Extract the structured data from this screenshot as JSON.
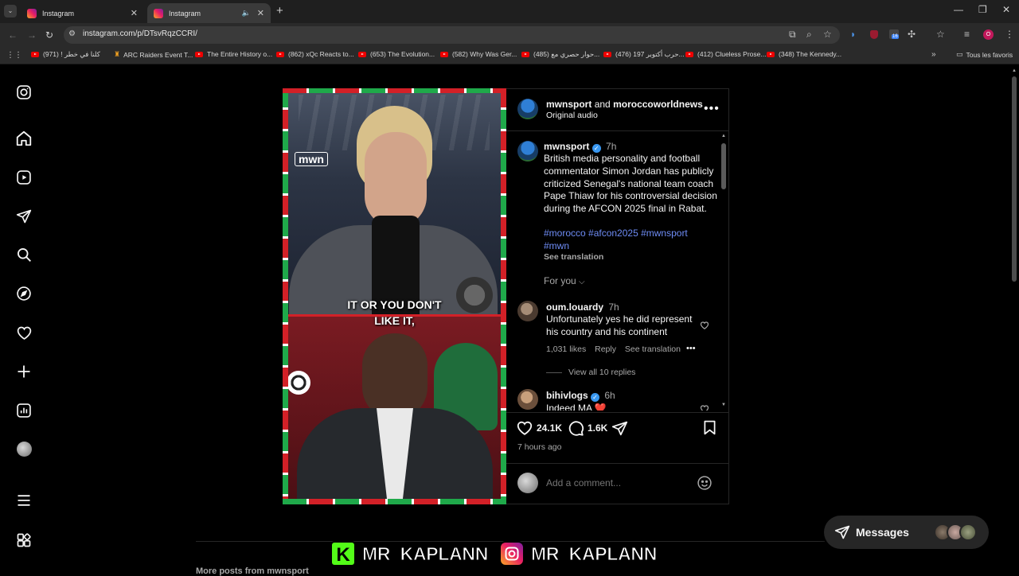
{
  "browser": {
    "tabs": [
      {
        "title": "Instagram",
        "active": false
      },
      {
        "title": "Instagram",
        "active": true
      }
    ],
    "url": "instagram.com/p/DTsvRqzCCRI/",
    "profile_initial": "O",
    "extension_badge": "16",
    "bookmarks": [
      "كلنا في خطر ! (971)",
      "ARC Raiders Event T...",
      "The Entire History o...",
      "(862) xQc Reacts to...",
      "(653) The Evolution...",
      "(582) Why Was Ger...",
      "(485) حوار حصري مع...",
      "(476) حرب أكتوبر 197...",
      "(412) Clueless Prose...",
      "(348) The Kennedy..."
    ],
    "all_bookmarks_label": "Tous les favoris"
  },
  "post": {
    "header": {
      "author1": "mwnsport",
      "joiner": "and",
      "author2": "moroccoworldnews",
      "audio": "Original audio",
      "more_icon": "more-horizontal-icon"
    },
    "video": {
      "caption_line1": "IT OR YOU DON'T",
      "caption_line2": "LIKE IT,",
      "logo_text": "mwn",
      "frame_colors": [
        "#d32027",
        "#1fa94a",
        "#ffffff"
      ]
    },
    "caption": {
      "username": "mwnsport",
      "verified": true,
      "time": "7h",
      "text": "British media personality and football commentator Simon Jordan has publicly criticized Senegal's national team coach Pape Thiaw for his controversial decision during the AFCON 2025 final in Rabat.",
      "hashtags": "#morocco #afcon2025 #mwnsport #mwn",
      "see_translation": "See translation"
    },
    "sort_label": "For you",
    "comments": [
      {
        "username": "oum.louardy",
        "time": "7h",
        "text": "Unfortunately yes he did represent his country and his continent",
        "likes": "1,031 likes",
        "reply": "Reply",
        "see_translation": "See translation",
        "view_replies": "View all 10 replies"
      },
      {
        "username": "bihivlogs",
        "verified": true,
        "time": "6h",
        "text": "Indeed MA ❤️"
      }
    ],
    "actions": {
      "likes": "24.1K",
      "comments": "1.6K"
    },
    "posted_ago": "7 hours ago",
    "comment_placeholder": "Add a comment...",
    "more_posts": "More posts from mwnsport"
  },
  "messages": {
    "label": "Messages"
  },
  "watermark": {
    "handle1": "MR_KAPLANN",
    "handle2": "MR_KAPLANN"
  }
}
